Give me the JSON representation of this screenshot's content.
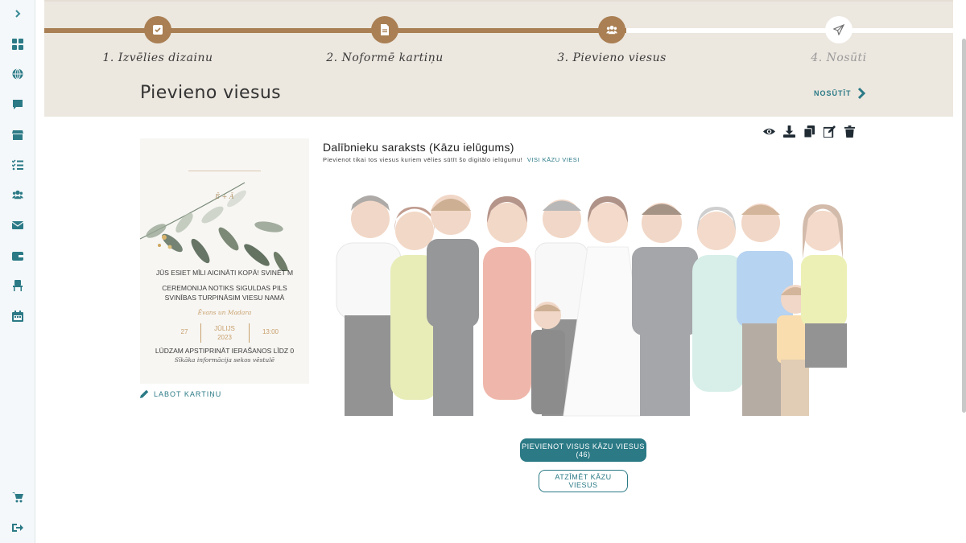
{
  "sidebar": {
    "icons": [
      "chevron-right-icon",
      "dashboard-icon",
      "globe-icon",
      "chat-icon",
      "store-icon",
      "checklist-icon",
      "users-icon",
      "envelope-icon",
      "wallet-icon",
      "chair-icon",
      "calendar-icon",
      "cart-icon",
      "logout-icon"
    ]
  },
  "steps": [
    {
      "label": "1. Izvēlies dizainu",
      "icon": "check-square-icon",
      "status": "done"
    },
    {
      "label": "2. Noformē kartiņu",
      "icon": "document-icon",
      "status": "done"
    },
    {
      "label": "3. Pievieno viesus",
      "icon": "users-icon",
      "status": "active"
    },
    {
      "label": "4. Nosūti",
      "icon": "paper-plane-icon",
      "status": "todo"
    }
  ],
  "header": {
    "title": "Pievieno viesus",
    "send_label": "NOSŪTĪT"
  },
  "card": {
    "monogram": "Ē + Ā",
    "line1": "JŪS ESIET MĪLI AICINĀTI KOPĀ! SVINĒT M",
    "line2": "CEREMONIJA NOTIKS SIGULDAS PILS",
    "line3": "SVINĪBAS TURPINĀSIM VIESU NAMĀ",
    "script1": "Ēvans un Madara",
    "day": "27",
    "month": "JŪLIJS",
    "year": "2023",
    "time": "13:00",
    "rsvp": "LŪDZAM APSTIPRINĀT IERAŠANOS LĪDZ 0",
    "script2": "Sīkāka informācija sekos vēstulē",
    "edit_label": "LABOT KARTIŅU"
  },
  "list": {
    "title": "Dalībnieku saraksts (Kāzu ielūgums)",
    "subtitle": "Pievienot tikai tos viesus kuriem vēlies sūtīt šo digitālo ielūgumu!",
    "all_guests_link": "VISI KĀZU VIESI"
  },
  "actions": {
    "icons": [
      "eye-icon",
      "download-icon",
      "copy-icon",
      "edit-icon",
      "trash-icon"
    ]
  },
  "buttons": {
    "add_all": "PIEVIENOT VISUS KĀZU VIESUS (46)",
    "mark": "ATZĪMĒT KĀZU VIESUS"
  },
  "colors": {
    "accent": "#2b7a86",
    "progress": "#a97f53",
    "header_bg": "#ece7df"
  }
}
